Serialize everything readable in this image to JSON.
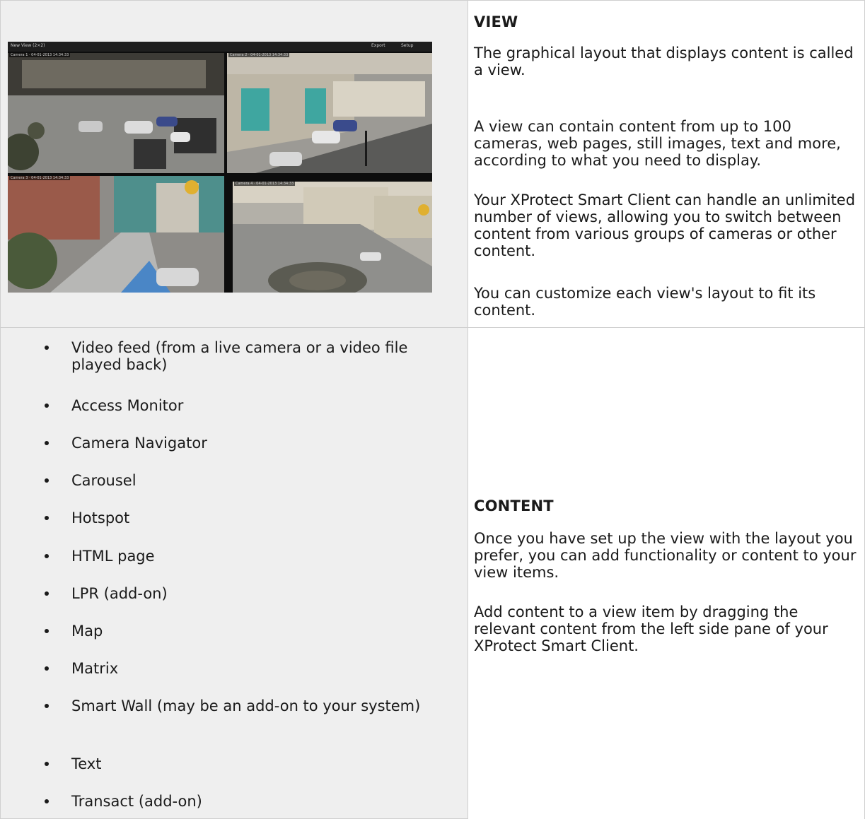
{
  "view_section": {
    "heading": "VIEW",
    "paragraphs": [
      "The graphical layout that displays content is called a view.",
      "A view can contain content from up to 100 cameras, web pages, still images, text and more, according to what you need to display.",
      "Your XProtect Smart Client can handle an unlimited number of views, allowing you to switch between content from various groups of cameras or other content.",
      "You can customize each view's layout to fit its content."
    ]
  },
  "screenshot": {
    "title": "New View (2×2)",
    "buttons": [
      "Export",
      "Setup"
    ],
    "pane_labels": [
      "Camera 1 · 04-01-2013 14:34:33",
      "Camera 2 · 04-01-2013 14:34:33",
      "Camera 3 · 04-01-2013 14:34:33",
      "Camera 4 · 04-01-2013 14:34:33"
    ]
  },
  "content_list": {
    "items": [
      "Video feed (from a live camera or a video file played back)",
      "Access Monitor",
      "Camera Navigator",
      "Carousel",
      "Hotspot",
      "HTML page",
      "LPR (add-on)",
      "Map",
      "Matrix",
      "Smart Wall (may be an add-on to your system)",
      "Text",
      "Transact (add-on)"
    ]
  },
  "content_section": {
    "heading": "CONTENT",
    "paragraphs": [
      "Once you have set up the view with the layout you prefer, you can add functionality or content to your view items.",
      "Add content to a view item by dragging the relevant content from the left side pane of your XProtect Smart Client."
    ]
  }
}
